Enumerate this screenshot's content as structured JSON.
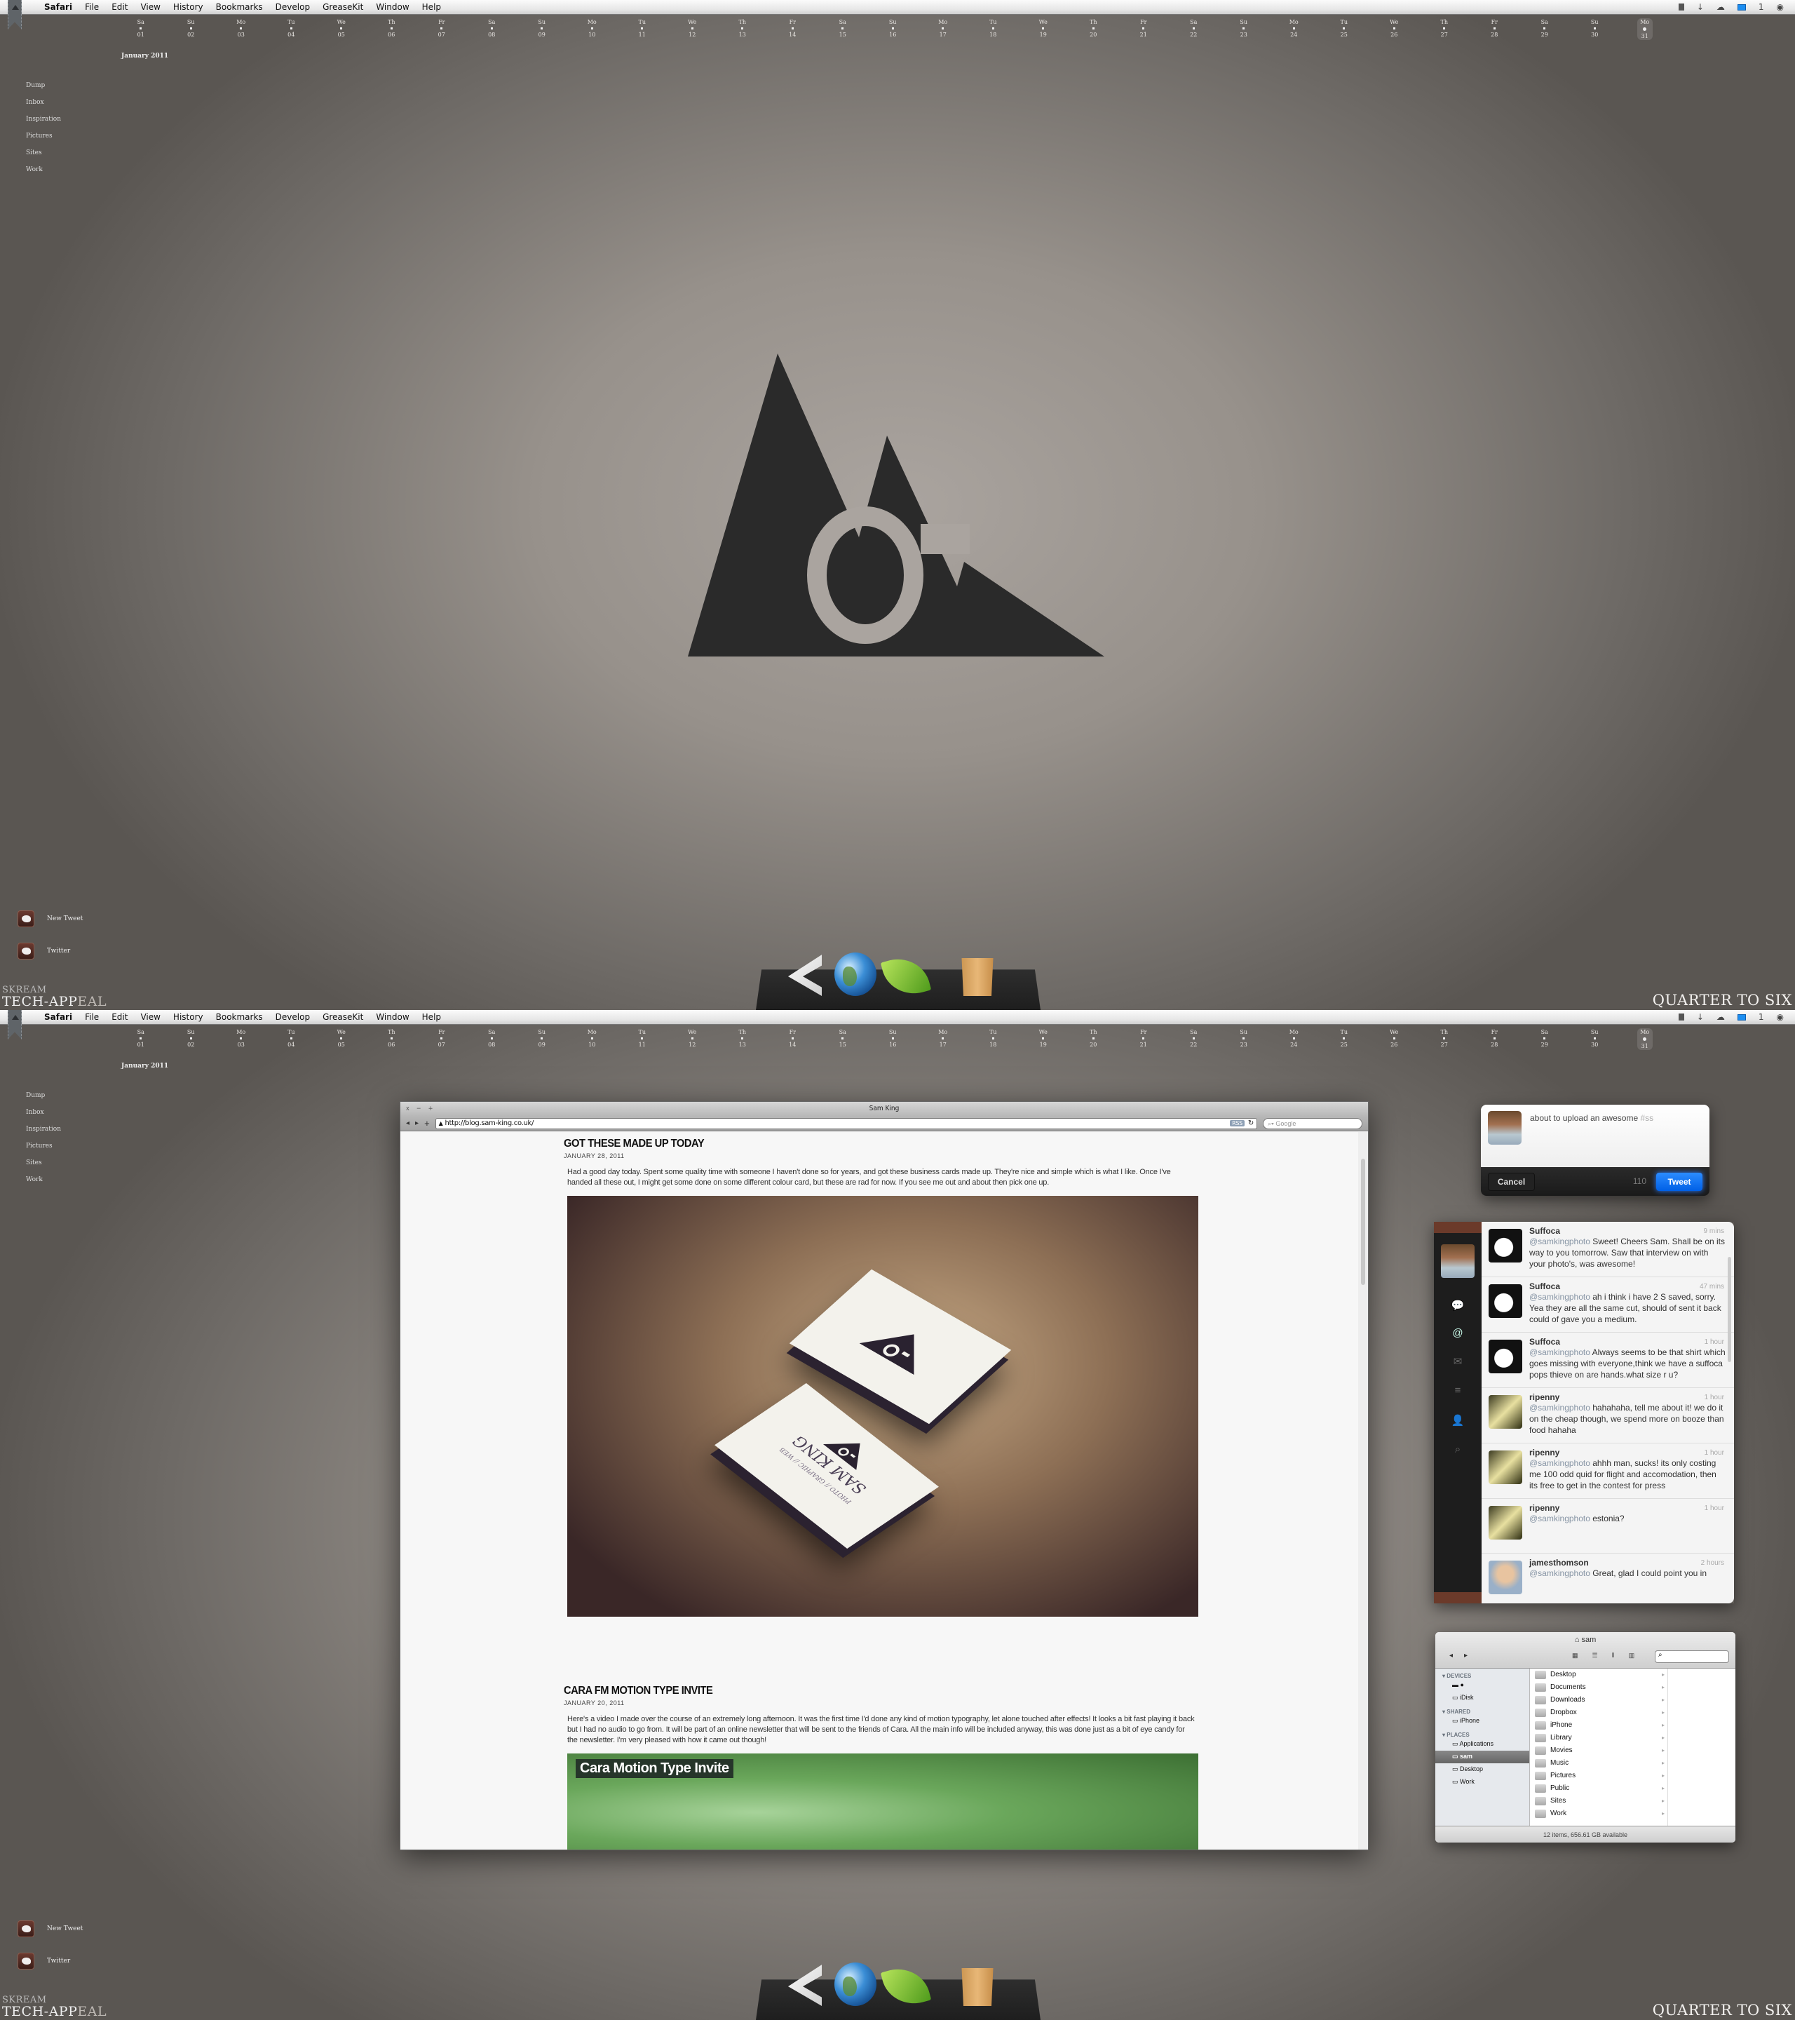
{
  "menubar": {
    "items": [
      "Safari",
      "File",
      "Edit",
      "View",
      "History",
      "Bookmarks",
      "Develop",
      "GreaseKit",
      "Window",
      "Help"
    ],
    "status": {
      "mail_count": "1"
    }
  },
  "calendar": {
    "month": "January 2011",
    "days": [
      {
        "d": "Sa",
        "n": "01"
      },
      {
        "d": "Su",
        "n": "02"
      },
      {
        "d": "Mo",
        "n": "03"
      },
      {
        "d": "Tu",
        "n": "04"
      },
      {
        "d": "We",
        "n": "05"
      },
      {
        "d": "Th",
        "n": "06"
      },
      {
        "d": "Fr",
        "n": "07"
      },
      {
        "d": "Sa",
        "n": "08"
      },
      {
        "d": "Su",
        "n": "09"
      },
      {
        "d": "Mo",
        "n": "10"
      },
      {
        "d": "Tu",
        "n": "11"
      },
      {
        "d": "We",
        "n": "12"
      },
      {
        "d": "Th",
        "n": "13"
      },
      {
        "d": "Fr",
        "n": "14"
      },
      {
        "d": "Sa",
        "n": "15"
      },
      {
        "d": "Su",
        "n": "16"
      },
      {
        "d": "Mo",
        "n": "17"
      },
      {
        "d": "Tu",
        "n": "18"
      },
      {
        "d": "We",
        "n": "19"
      },
      {
        "d": "Th",
        "n": "20"
      },
      {
        "d": "Fr",
        "n": "21"
      },
      {
        "d": "Sa",
        "n": "22"
      },
      {
        "d": "Su",
        "n": "23"
      },
      {
        "d": "Mo",
        "n": "24"
      },
      {
        "d": "Tu",
        "n": "25"
      },
      {
        "d": "We",
        "n": "26"
      },
      {
        "d": "Th",
        "n": "27"
      },
      {
        "d": "Fr",
        "n": "28"
      },
      {
        "d": "Sa",
        "n": "29"
      },
      {
        "d": "Su",
        "n": "30"
      },
      {
        "d": "Mo",
        "n": "31",
        "today": true
      }
    ]
  },
  "folders": [
    "Dump",
    "Inbox",
    "Inspiration",
    "Pictures",
    "Sites",
    "Work"
  ],
  "desktop_icons": [
    {
      "label": "New Tweet"
    },
    {
      "label": "Twitter"
    }
  ],
  "brand": {
    "top": "SKREAM",
    "main": "TECH-APP",
    "main_dim": "EAL"
  },
  "clock": "QUARTER TO SIX",
  "dock": [
    "penrose-app",
    "globe-browser",
    "coda-leaf",
    "trash"
  ],
  "browser": {
    "title": "Sam King",
    "controls": [
      "x",
      "−",
      "+"
    ],
    "url": "http://blog.sam-king.co.uk/",
    "rss": "RSS",
    "search_placeholder": "Google",
    "posts": [
      {
        "title": "GOT THESE MADE UP TODAY",
        "date": "JANUARY 28, 2011",
        "body": "Had a good day today. Spent some quality time with someone I haven't done so for years, and got these business cards made up. They're nice and simple which is what I like. Once I've handed all these out, I might get some done on some different colour card, but these are rad for now. If you see me out and about then pick one up.",
        "card_name": "SAM KING",
        "card_sub": "PHOTO // GRAPHIC // WEB"
      },
      {
        "title": "CARA FM MOTION TYPE INVITE",
        "date": "JANUARY 20, 2011",
        "body": "Here's a video I made over the course of an extremely long afternoon. It was the first time I'd done any kind of motion typography, let alone touched after effects! It looks a bit fast playing it back but I had no audio to go from. It will be part of an online newsletter that will be sent to the friends of Cara. All the main info will be included anyway, this was done just as a bit of eye candy for the newsletter. I'm very pleased with how it came out though!",
        "video_title": "Cara Motion Type Invite"
      }
    ]
  },
  "compose": {
    "text": "about to upload an awesome ",
    "tag": "#ss",
    "cancel": "Cancel",
    "count": "110",
    "tweet": "Tweet"
  },
  "timeline": [
    {
      "name": "Suffoca",
      "time": "9 mins",
      "mention": "@samkingphoto",
      "text": " Sweet! Cheers Sam. Shall be on its way to you tomorrow. Saw that interview on with your photo's, was awesome!",
      "av": "suff"
    },
    {
      "name": "Suffoca",
      "time": "47 mins",
      "mention": "@samkingphoto",
      "text": " ah i think i have 2 S saved, sorry. Yea they are all the same cut, should of sent it back could of gave you a medium.",
      "av": "suff"
    },
    {
      "name": "Suffoca",
      "time": "1 hour",
      "mention": "@samkingphoto",
      "text": " Always seems to be that shirt which goes missing with everyone,think we have a suffoca pops thieve on are hands.what size r u?",
      "av": "suff"
    },
    {
      "name": "ripenny",
      "time": "1 hour",
      "mention": "@samkingphoto",
      "text": " hahahaha, tell me about it! we do it on the cheap though, we spend more on booze than food hahaha",
      "av": "rip"
    },
    {
      "name": "ripenny",
      "time": "1 hour",
      "mention": "@samkingphoto",
      "text": " ahhh man, sucks! its only costing me 100 odd quid for flight and accomodation, then its free to get in the contest for press",
      "av": "rip"
    },
    {
      "name": "ripenny",
      "time": "1 hour",
      "mention": "@samkingphoto",
      "text": " estonia?",
      "av": "rip"
    },
    {
      "name": "jamesthomson",
      "time": "2 hours",
      "mention": "@samkingphoto",
      "text": " Great, glad I could point you in",
      "av": "james"
    }
  ],
  "finder": {
    "title": "sam",
    "sections": [
      {
        "header": "DEVICES",
        "items": [
          "",
          "iDisk"
        ]
      },
      {
        "header": "SHARED",
        "items": [
          "iPhone"
        ]
      },
      {
        "header": "PLACES",
        "items": [
          "Applications",
          "sam",
          "Desktop",
          "Work"
        ],
        "selected": "sam"
      }
    ],
    "files": [
      "Desktop",
      "Documents",
      "Downloads",
      "Dropbox",
      "iPhone",
      "Library",
      "Movies",
      "Music",
      "Pictures",
      "Public",
      "Sites",
      "Work"
    ],
    "status": "12 items, 656.61 GB available"
  }
}
